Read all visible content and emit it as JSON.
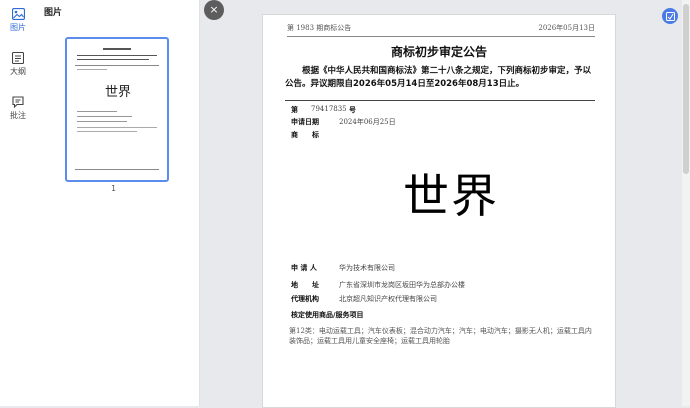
{
  "sidebar": {
    "items": [
      {
        "label": "图片",
        "icon": "image-icon",
        "active": true
      },
      {
        "label": "大纲",
        "icon": "outline-icon",
        "active": false
      },
      {
        "label": "批注",
        "icon": "comment-icon",
        "active": false
      }
    ]
  },
  "thumbs": {
    "title": "图片",
    "thumb_mark": "世界",
    "page_number": "1"
  },
  "close_label": "×",
  "document": {
    "issue": "第 1983 期商标公告",
    "date": "2026年05月13日",
    "title": "商标初步审定公告",
    "intro": "根据《中华人民共和国商标法》第二十八条之规定，下列商标初步审定，予以公告。异议期限自2026年05月14日至2026年08月13日止。",
    "reg_label": "第",
    "reg_no": "79417835",
    "reg_suffix": "号",
    "filing_label": "申请日期",
    "filing_date": "2024年06月25日",
    "mark_label": "商　　标",
    "mark_text": "世界",
    "applicant_label": "申 请 人",
    "applicant": "华为技术有限公司",
    "address_label": "地　　址",
    "address": "广东省深圳市龙岗区坂田华为总部办公楼",
    "agent_label": "代理机构",
    "agent": "北京超凡知识产权代理有限公司",
    "goods_label": "核定使用商品/服务项目",
    "goods": "第12类：电动运载工具；汽车仪表板；混合动力汽车；汽车；电动汽车；摄影无人机；运载工具内装饰品；运载工具用儿童安全座椅；运载工具用轮胎"
  },
  "colors": {
    "accent": "#2f6bd8",
    "selection": "#5b8def"
  }
}
